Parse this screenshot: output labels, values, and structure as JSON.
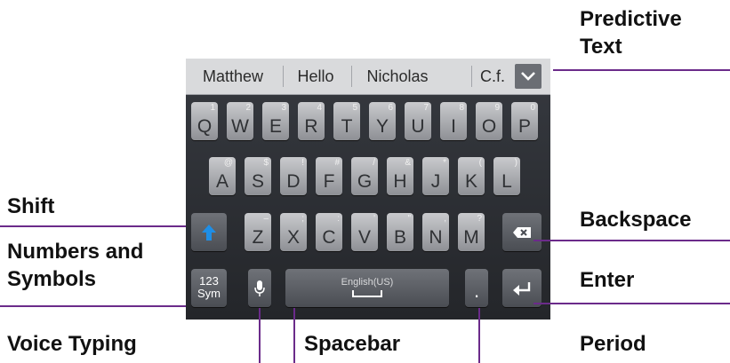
{
  "predictive": {
    "words": [
      "Matthew",
      "Hello",
      "Nicholas",
      "C.f."
    ]
  },
  "keys": {
    "row1": [
      {
        "m": "Q",
        "s": "1"
      },
      {
        "m": "W",
        "s": "2"
      },
      {
        "m": "E",
        "s": "3"
      },
      {
        "m": "R",
        "s": "4"
      },
      {
        "m": "T",
        "s": "5"
      },
      {
        "m": "Y",
        "s": "6"
      },
      {
        "m": "U",
        "s": "7"
      },
      {
        "m": "I",
        "s": "8"
      },
      {
        "m": "O",
        "s": "9"
      },
      {
        "m": "P",
        "s": "0"
      }
    ],
    "row2": [
      {
        "m": "A",
        "s": "@"
      },
      {
        "m": "S",
        "s": "$"
      },
      {
        "m": "D",
        "s": "!"
      },
      {
        "m": "F",
        "s": "#"
      },
      {
        "m": "G",
        "s": "/"
      },
      {
        "m": "H",
        "s": "&"
      },
      {
        "m": "J",
        "s": "*"
      },
      {
        "m": "K",
        "s": "("
      },
      {
        "m": "L",
        "s": ")"
      }
    ],
    "row3": [
      {
        "m": "Z",
        "s": "–"
      },
      {
        "m": "X",
        "s": ";"
      },
      {
        "m": "C",
        "s": ":"
      },
      {
        "m": "V",
        "s": "'"
      },
      {
        "m": "B",
        "s": "\""
      },
      {
        "m": "N",
        "s": ","
      },
      {
        "m": "M",
        "s": "?"
      }
    ]
  },
  "sym": {
    "top": "123",
    "bottom": "Sym"
  },
  "space": {
    "language": "English(US)"
  },
  "period": {
    "char": "."
  },
  "labels": {
    "predictive_line1": "Predictive",
    "predictive_line2": "Text",
    "shift": "Shift",
    "numbers_line1": "Numbers and",
    "numbers_line2": "Symbols",
    "voice": "Voice Typing",
    "spacebar": "Spacebar",
    "backspace": "Backspace",
    "enter": "Enter",
    "period": "Period"
  },
  "colors": {
    "callout_line": "#6b2b8a",
    "shift_arrow": "#1e8ee6",
    "keyboard_bg": "#2c2e33"
  }
}
